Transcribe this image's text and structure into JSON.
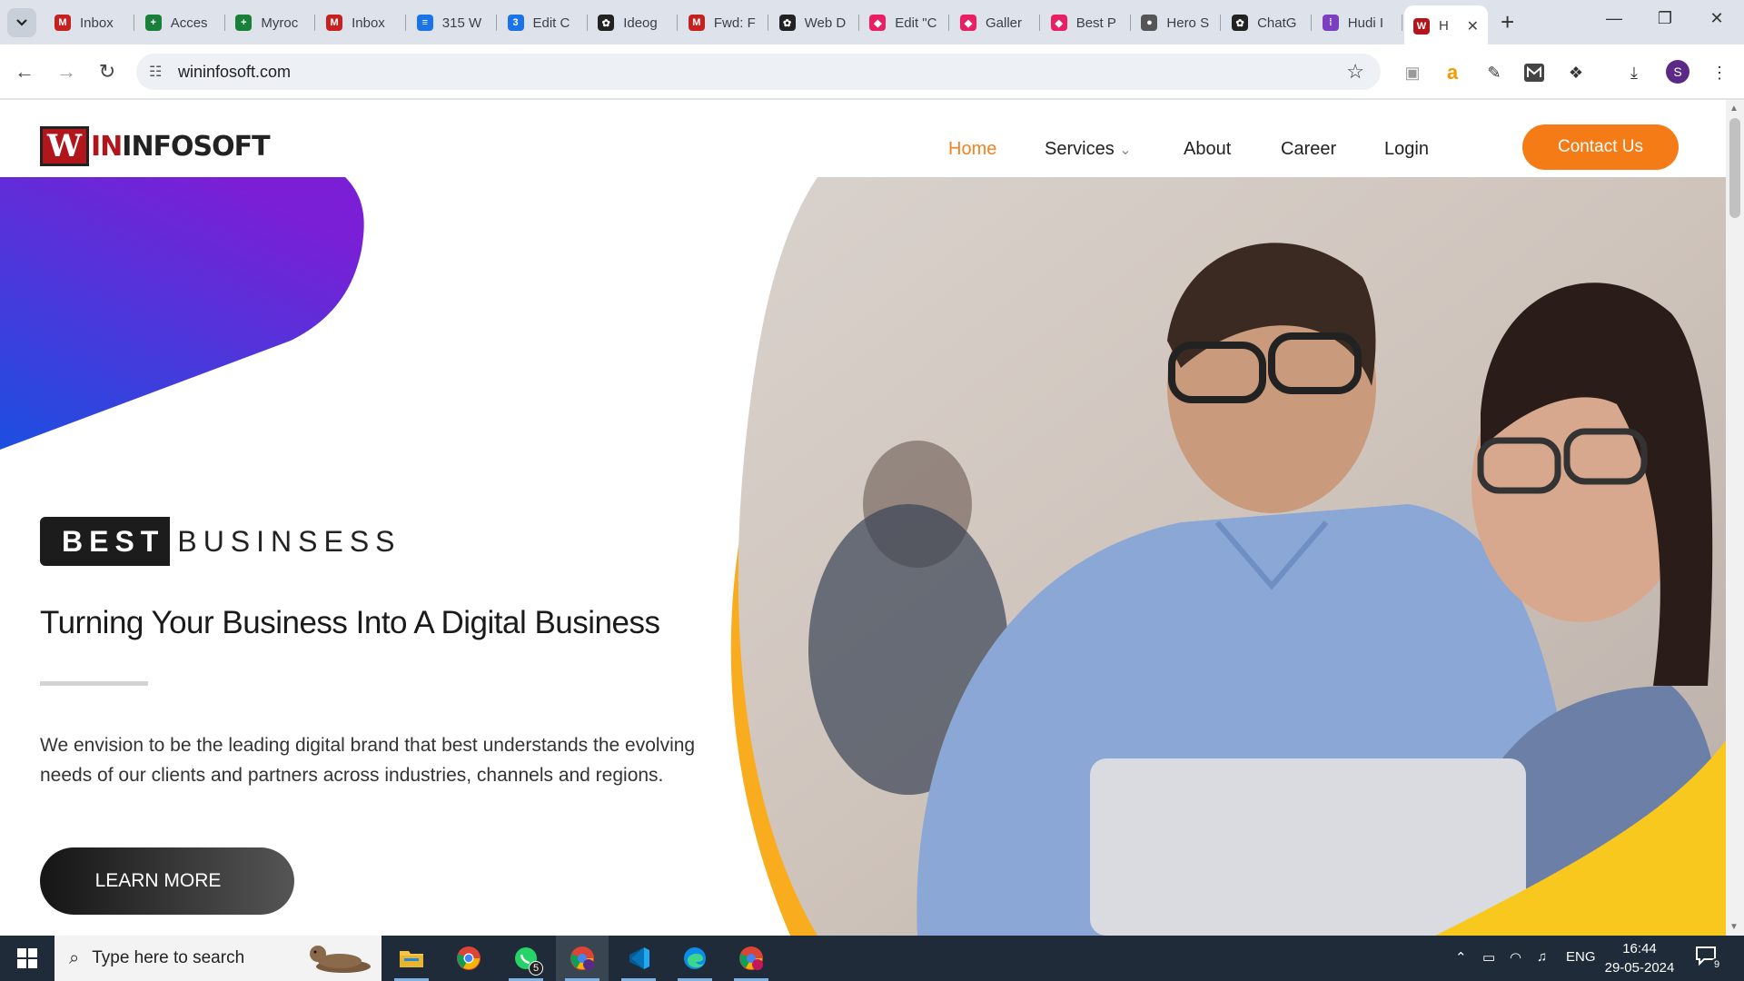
{
  "browser": {
    "tabs": [
      {
        "label": "Inbox",
        "icon": "gmail-icon",
        "color": "#c5221f"
      },
      {
        "label": "Acces",
        "icon": "sheets-icon",
        "color": "#188038"
      },
      {
        "label": "Myroc",
        "icon": "sheets-icon",
        "color": "#188038"
      },
      {
        "label": "Inbox",
        "icon": "gmail-icon",
        "color": "#c5221f"
      },
      {
        "label": "315 W",
        "icon": "docs-icon",
        "color": "#1a73e8"
      },
      {
        "label": "Edit C",
        "icon": "315-icon",
        "color": "#1a73e8"
      },
      {
        "label": "Ideog",
        "icon": "openai-icon",
        "color": "#222222"
      },
      {
        "label": "Fwd: F",
        "icon": "gmail-icon",
        "color": "#c5221f"
      },
      {
        "label": "Web D",
        "icon": "openai-icon",
        "color": "#222222"
      },
      {
        "label": "Edit \"C",
        "icon": "pink-logo-icon",
        "color": "#e91e63"
      },
      {
        "label": "Galler",
        "icon": "pink-logo-icon",
        "color": "#e91e63"
      },
      {
        "label": "Best P",
        "icon": "pink-logo-icon",
        "color": "#e91e63"
      },
      {
        "label": "Hero S",
        "icon": "globe-icon",
        "color": "#555555"
      },
      {
        "label": "ChatG",
        "icon": "openai-icon",
        "color": "#222222"
      },
      {
        "label": "Hudi I",
        "icon": "hudi-icon",
        "color": "#7b3fbf"
      }
    ],
    "active_tab": {
      "label": "H",
      "icon": "wininfosoft-icon",
      "close": "✕"
    },
    "new_tab": "+",
    "url": "wininfosoft.com",
    "profile_initial": "S"
  },
  "site": {
    "logo": {
      "mark": "W",
      "word_red": "IN",
      "word_dark": "INFOSOFT"
    },
    "nav": [
      {
        "label": "Home",
        "active": true
      },
      {
        "label": "Services",
        "caret": "⌄"
      },
      {
        "label": "About"
      },
      {
        "label": "Career"
      },
      {
        "label": "Login"
      }
    ],
    "contact_button": "Contact Us",
    "badge_dark": "BEST",
    "badge_light": "BUSINSESS",
    "headline": "Turning Your Business Into A Digital Business",
    "paragraph": "We envision to be the leading digital brand that best understands the evolving needs of our clients and partners across industries, channels and regions.",
    "learn_more": "LEARN MORE",
    "colors": {
      "accent": "#f47b16",
      "blob_top": "#7b1fd6",
      "blob_bottom": "#1c4fe0",
      "wave": "#f9ac1e"
    }
  },
  "taskbar": {
    "search_placeholder": "Type here to search",
    "whatsapp_badge": "5",
    "tray_lang": "ENG",
    "time": "16:44",
    "date": "29-05-2024",
    "notifications": "9"
  }
}
